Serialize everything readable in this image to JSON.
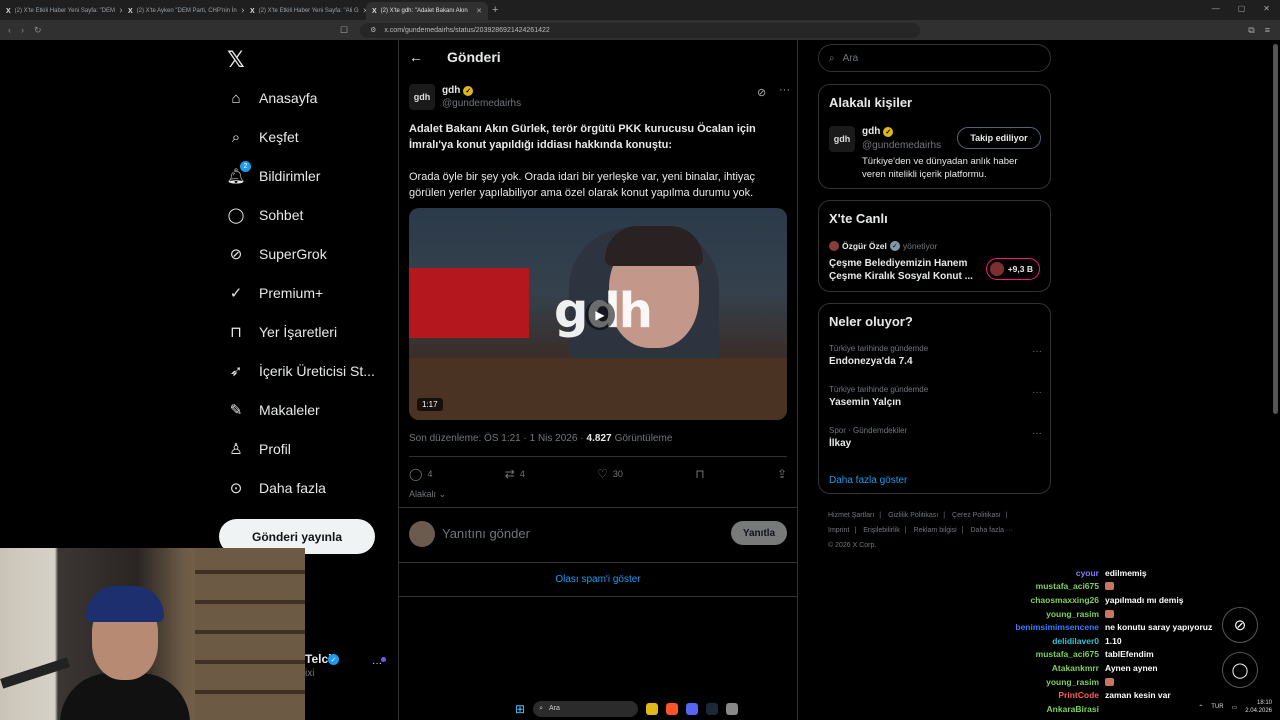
{
  "browser": {
    "tabs": [
      {
        "label": "(2) X'te Etkili Haber Yeni Sayfa: \"DEM",
        "active": false
      },
      {
        "label": "(2) X'te Ayken \"DEM Parti, CHP'nin İn",
        "active": false
      },
      {
        "label": "(2) X'te Etkili Haber Yeni Sayfa: \"Ali G",
        "active": false
      },
      {
        "label": "(2) X'te gdh: \"Adalet Bakanı Akın",
        "active": true
      }
    ],
    "url": "x.com/gundemedairhs/status/2039286921424261422"
  },
  "nav": {
    "items": [
      {
        "label": "Anasayfa",
        "icon": "home-icon"
      },
      {
        "label": "Keşfet",
        "icon": "search-icon"
      },
      {
        "label": "Bildirimler",
        "icon": "bell-icon",
        "badge": "2"
      },
      {
        "label": "Sohbet",
        "icon": "chat-icon"
      },
      {
        "label": "SuperGrok",
        "icon": "grok-icon"
      },
      {
        "label": "Premium+",
        "icon": "premium-icon"
      },
      {
        "label": "Yer İşaretleri",
        "icon": "bookmark-icon"
      },
      {
        "label": "İçerik Üreticisi St...",
        "icon": "rocket-icon"
      },
      {
        "label": "Makaleler",
        "icon": "article-icon"
      },
      {
        "label": "Profil",
        "icon": "profile-icon"
      },
      {
        "label": "Daha fazla",
        "icon": "more-circle-icon"
      }
    ],
    "post_button": "Gönderi yayınla",
    "profile_name_partial": "Telci",
    "profile_handle_partial": "ixi"
  },
  "main": {
    "header_title": "Gönderi",
    "author": {
      "avatar_text": "gdh",
      "name": "gdh",
      "handle": "@gundemedairhs"
    },
    "tweet_bold": "Adalet Bakanı Akın Gürlek, terör örgütü PKK kurucusu Öcalan için İmralı'ya konut yapıldığı iddiası hakkında konuştu:",
    "tweet_body": "Orada öyle bir şey yok. Orada idari bir yerleşke var, yeni binalar, ihtiyaç görülen yerler yapılabiliyor ama özel olarak konut yapılma durumu yok.",
    "video": {
      "logo_text": "gdh",
      "duration": "1:17"
    },
    "meta": {
      "edited": "Son düzenleme: ÖS 1:21 · 1 Nis 2026 ·",
      "views": "4.827",
      "views_label": "Görüntüleme"
    },
    "actions": {
      "replies": "4",
      "reposts": "4",
      "likes": "30"
    },
    "related_label": "Alakalı",
    "reply_placeholder": "Yanıtını gönder",
    "reply_button": "Yanıtla",
    "spam_link": "Olası spam'i göster"
  },
  "right": {
    "search_placeholder": "Ara",
    "related_people": {
      "title": "Alakalı kişiler",
      "avatar_text": "gdh",
      "name": "gdh",
      "handle": "@gundemedairhs",
      "follow_label": "Takip ediliyor",
      "bio": "Türkiye'den ve dünyadan anlık haber veren nitelikli içerik platformu."
    },
    "live": {
      "title": "X'te Canlı",
      "host": "Özgür Özel",
      "host_role": "yönetiyor",
      "stream_title": "Çeşme Belediyemizin Hanem Çeşme Kiralık Sosyal Konut ...",
      "listeners": "+9,3 B"
    },
    "trends": {
      "title": "Neler oluyor?",
      "items": [
        {
          "context": "Türkiye tarihinde gündemde",
          "name": "Endonezya'da 7.4"
        },
        {
          "context": "Türkiye tarihinde gündemde",
          "name": "Yasemin Yalçın"
        },
        {
          "context": "Spor · Gündemdekiler",
          "name": "İlkay"
        }
      ],
      "show_more": "Daha fazla göster"
    },
    "footer": {
      "links": [
        "Hizmet Şartları",
        "|",
        "Gizlilik Politikası",
        "|",
        "Çerez Politikası",
        "|",
        "Imprint",
        "|",
        "Erişilebilirlik",
        "|",
        "Reklam bilgisi",
        "|",
        "Daha fazla ···"
      ],
      "copyright": "© 2026 X Corp."
    }
  },
  "chat": [
    {
      "user": "cyour",
      "msg": "edilmemiş",
      "color": "#8a7bff"
    },
    {
      "user": "mustafa_aci675",
      "msg": "",
      "emote": true,
      "color": "#7fd15b"
    },
    {
      "user": "chaosmaxxing26",
      "msg": "yapılmadı mı demiş",
      "color": "#7fd15b"
    },
    {
      "user": "young_rasim",
      "msg": "",
      "emote": true,
      "color": "#7fd15b"
    },
    {
      "user": "benimsimimsencene",
      "msg": "ne konutu saray yapıyoruz",
      "color": "#3a7bff"
    },
    {
      "user": "delidilaver0",
      "msg": "1.10",
      "color": "#39c2d6"
    },
    {
      "user": "mustafa_aci675",
      "msg": "tablEfendim",
      "color": "#7fd15b"
    },
    {
      "user": "Atakankmrr",
      "msg": "Aynen aynen",
      "color": "#7fd15b"
    },
    {
      "user": "young_rasim",
      "msg": "",
      "emote": true,
      "color": "#7fd15b"
    },
    {
      "user": "PrintCode",
      "msg": "zaman kesin var",
      "color": "#ff5a5a"
    },
    {
      "user": "AnkaraBirasi",
      "msg": "",
      "color": "#7fd15b"
    }
  ],
  "taskbar": {
    "search": "Ara",
    "lang": "TUR",
    "time": "18:10",
    "date": "2.04.2026"
  }
}
